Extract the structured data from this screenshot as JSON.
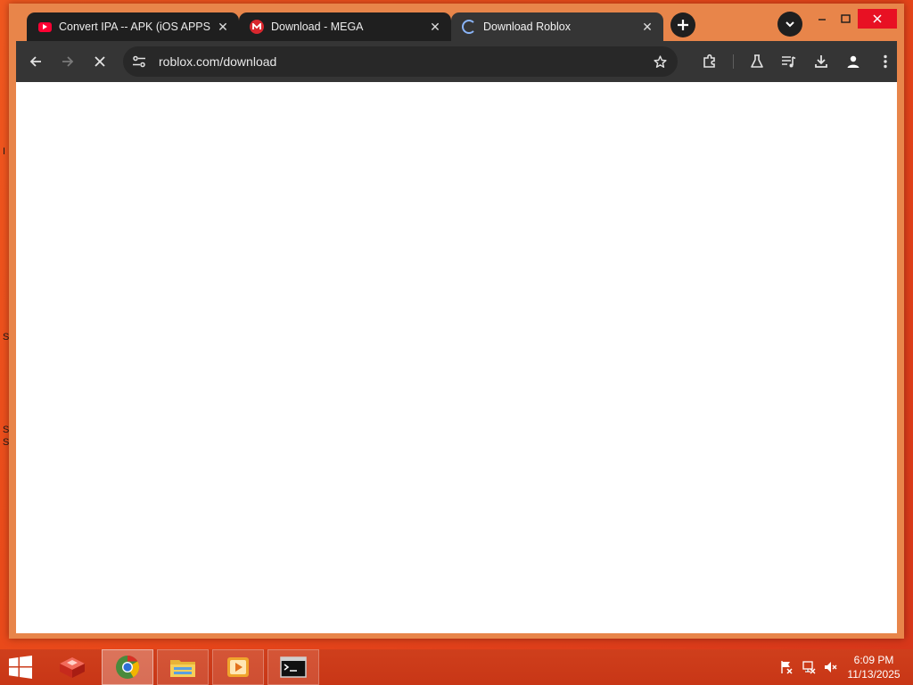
{
  "desktop": {
    "edge_fragments": [
      "I",
      "S",
      "S",
      "S"
    ]
  },
  "browser": {
    "tabs": [
      {
        "label": "Convert IPA -- APK (iOS APPS C",
        "favicon": "youtube-icon",
        "active": false
      },
      {
        "label": "Download - MEGA",
        "favicon": "mega-icon",
        "active": false
      },
      {
        "label": "Download Roblox",
        "favicon": "loading-spinner-icon",
        "active": true
      }
    ],
    "new_tab_icon": "plus-icon",
    "tab_search_icon": "chevron-down-icon",
    "window_controls": [
      "minimize-icon",
      "maximize-icon",
      "close-icon"
    ],
    "toolbar": {
      "back_icon": "arrow-left-icon",
      "forward_icon": "arrow-right-icon",
      "stop_icon": "x-stop-icon",
      "url": "roblox.com/download",
      "site_info_icon": "tune-icon",
      "bookmark_icon": "star-icon",
      "right_icons": [
        "extensions-icon",
        "labs-flask-icon",
        "media-queue-icon",
        "download-icon",
        "profile-icon",
        "more-vert-icon"
      ]
    },
    "colors": {
      "frame": "#e8854a",
      "tab_inactive": "#1f1f1f",
      "tab_active": "#353535",
      "toolbar": "#353535",
      "omnibox": "#282828",
      "accent": "#8ab4f8"
    }
  },
  "taskbar": {
    "apps": [
      "start-windows-icon",
      "app-red-box-icon",
      "chrome-icon",
      "file-explorer-icon",
      "media-player-icon",
      "command-prompt-icon"
    ],
    "tray": [
      "action-center-flag-icon",
      "network-icon",
      "volume-muted-icon"
    ],
    "clock": {
      "time": "6:09 PM",
      "date": "11/13/2025"
    }
  }
}
